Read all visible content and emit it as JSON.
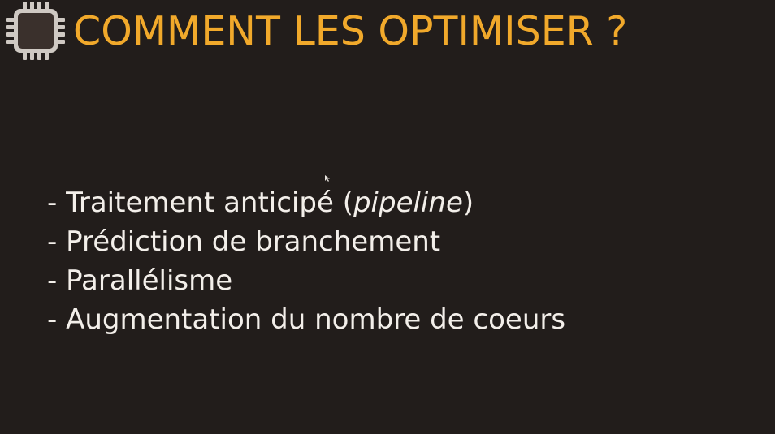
{
  "slide": {
    "title": "COMMENT LES OPTIMISER ?",
    "icon": "cpu-chip-icon",
    "colors": {
      "background": "#221d1b",
      "title": "#f1a92b",
      "text": "#f3efea",
      "chip": "#3a302c"
    },
    "bullets": [
      {
        "prefix": "- Traitement anticipé (",
        "emphasis": "pipeline",
        "suffix": ")"
      },
      {
        "prefix": "- Prédiction de branchement",
        "emphasis": "",
        "suffix": ""
      },
      {
        "prefix": "- Parallélisme",
        "emphasis": "",
        "suffix": ""
      },
      {
        "prefix": "- Augmentation du nombre de coeurs",
        "emphasis": "",
        "suffix": ""
      }
    ]
  }
}
